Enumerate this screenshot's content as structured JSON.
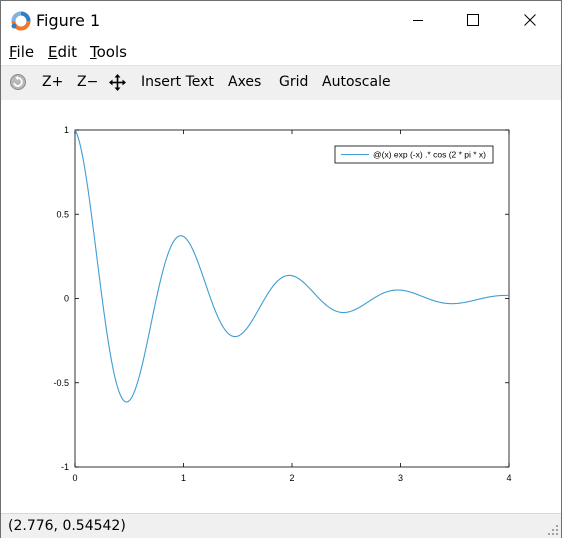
{
  "window": {
    "title": "Figure 1"
  },
  "menubar": {
    "items": [
      {
        "label": "File",
        "mnemonic": "F",
        "rest": "ile"
      },
      {
        "label": "Edit",
        "mnemonic": "E",
        "rest": "dit"
      },
      {
        "label": "Tools",
        "mnemonic": "T",
        "rest": "ools"
      }
    ]
  },
  "toolbar": {
    "rotate_icon": "rotate-icon",
    "zoom_in_label": "Z+",
    "zoom_out_label": "Z−",
    "pan_icon": "pan-arrows-icon",
    "insert_text_label": "Insert Text",
    "axes_label": "Axes",
    "grid_label": "Grid",
    "autoscale_label": "Autoscale"
  },
  "status": {
    "coordinates": "(2.776, 0.54542)"
  },
  "colors": {
    "line": "#3f9dd3",
    "toolbar_bg": "#f0f0f0",
    "status_bg": "#f0f0f0"
  },
  "chart_data": {
    "type": "line",
    "function": "@(x) exp (-x) .* cos (2 * pi * x)",
    "series": [
      {
        "name": "@(x) exp (-x) .* cos (2 * pi * x)",
        "expression": "exp(-x)*cos(2*pi*x)",
        "x_range": [
          0,
          4
        ]
      }
    ],
    "xlim": [
      0,
      4
    ],
    "ylim": [
      -1,
      1
    ],
    "xticks": [
      "0",
      "1",
      "2",
      "3",
      "4"
    ],
    "yticks": [
      "1",
      "0.5",
      "0",
      "-0.5",
      "-1"
    ],
    "grid": false,
    "legend_position": "top-right"
  }
}
